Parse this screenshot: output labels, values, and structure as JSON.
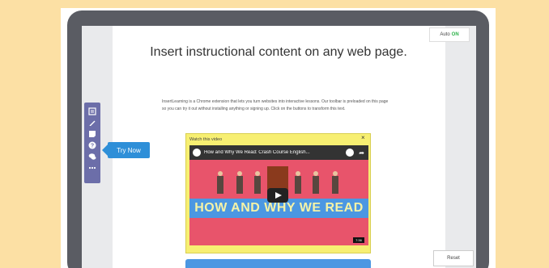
{
  "auto": {
    "label": "Auto",
    "status": "ON"
  },
  "page": {
    "title": "Insert instructional content on any web page.",
    "intro": "InsertLearning is a Chrome extension that lets you turn websites into interactive lessons. Our toolbar is preloaded on this page so you can try it out without installing anything or signing up. Click on the buttons to transform this text."
  },
  "toolbar": {
    "items": [
      {
        "icon": "highlight-icon"
      },
      {
        "icon": "pencil-icon"
      },
      {
        "icon": "note-icon"
      },
      {
        "icon": "question-icon"
      },
      {
        "icon": "discussion-icon"
      },
      {
        "icon": "more-icon"
      }
    ]
  },
  "tryNow": {
    "label": "Try Now"
  },
  "videoWidget": {
    "label": "Watch this video",
    "close": "×",
    "video": {
      "title": "How and Why We Read: Crash Course English...",
      "bannerText": "HOW AND WHY WE READ",
      "duration": "7:36"
    }
  },
  "reset": {
    "label": "Reset"
  },
  "colors": {
    "background": "#fce0a4",
    "laptop": "#5a5c63",
    "toolbar": "#6c6ea9",
    "tryNow": "#2e8fd8",
    "widget": "#f7ef72",
    "videoRed": "#e8546b",
    "videoBlue": "#4b97e2",
    "autoOn": "#2db34a"
  }
}
